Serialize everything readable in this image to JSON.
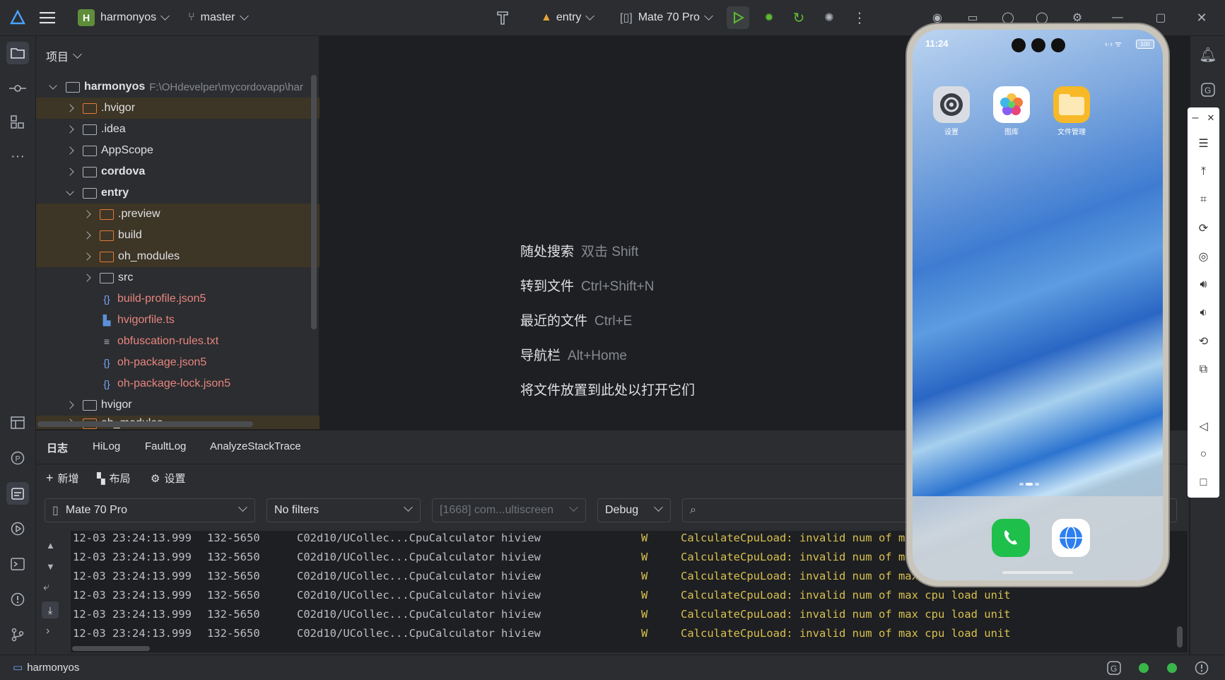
{
  "titlebar": {
    "project_badge": "H",
    "project_name": "harmonyos",
    "branch": "master",
    "run_config": "entry",
    "device": "Mate 70 Pro"
  },
  "project_panel": {
    "title": "项目",
    "root_name": "harmonyos",
    "root_path": "F:\\OHdevelper\\mycordovapp\\har",
    "items": [
      {
        "label": ".hvigor"
      },
      {
        "label": ".idea"
      },
      {
        "label": "AppScope"
      },
      {
        "label": "cordova"
      },
      {
        "label": "entry"
      },
      {
        "label": ".preview"
      },
      {
        "label": "build"
      },
      {
        "label": "oh_modules"
      },
      {
        "label": "src"
      },
      {
        "label": "build-profile.json5"
      },
      {
        "label": "hvigorfile.ts"
      },
      {
        "label": "obfuscation-rules.txt"
      },
      {
        "label": "oh-package.json5"
      },
      {
        "label": "oh-package-lock.json5"
      },
      {
        "label": "hvigor"
      },
      {
        "label": "oh_modules"
      }
    ]
  },
  "editor_hints": [
    {
      "label": "随处搜索",
      "key": "双击 Shift"
    },
    {
      "label": "转到文件",
      "key": "Ctrl+Shift+N"
    },
    {
      "label": "最近的文件",
      "key": "Ctrl+E"
    },
    {
      "label": "导航栏",
      "key": "Alt+Home"
    },
    {
      "label": "将文件放置到此处以打开它们",
      "key": ""
    }
  ],
  "log_panel": {
    "tabs": [
      "日志",
      "HiLog",
      "FaultLog",
      "AnalyzeStackTrace"
    ],
    "toolbar": {
      "new": "新增",
      "layout": "布局",
      "settings": "设置"
    },
    "device_select": "Mate 70 Pro",
    "filter_select": "No filters",
    "process_select": "[1668] com...ultiscreen",
    "level_select": "Debug",
    "rows": [
      {
        "time": "12-03 23:24:13.999",
        "pid": "132-5650",
        "tag": "C02d10/UCollec...CpuCalculator",
        "proc": "hiview",
        "level": "W",
        "msg": "CalculateCpuLoad: invalid num of max cpu load unit"
      },
      {
        "time": "12-03 23:24:13.999",
        "pid": "132-5650",
        "tag": "C02d10/UCollec...CpuCalculator",
        "proc": "hiview",
        "level": "W",
        "msg": "CalculateCpuLoad: invalid num of max cpu load unit"
      },
      {
        "time": "12-03 23:24:13.999",
        "pid": "132-5650",
        "tag": "C02d10/UCollec...CpuCalculator",
        "proc": "hiview",
        "level": "W",
        "msg": "CalculateCpuLoad: invalid num of max cpu load unit"
      },
      {
        "time": "12-03 23:24:13.999",
        "pid": "132-5650",
        "tag": "C02d10/UCollec...CpuCalculator",
        "proc": "hiview",
        "level": "W",
        "msg": "CalculateCpuLoad: invalid num of max cpu load unit"
      },
      {
        "time": "12-03 23:24:13.999",
        "pid": "132-5650",
        "tag": "C02d10/UCollec...CpuCalculator",
        "proc": "hiview",
        "level": "W",
        "msg": "CalculateCpuLoad: invalid num of max cpu load unit"
      },
      {
        "time": "12-03 23:24:13.999",
        "pid": "132-5650",
        "tag": "C02d10/UCollec...CpuCalculator",
        "proc": "hiview",
        "level": "W",
        "msg": "CalculateCpuLoad: invalid num of max cpu load unit"
      }
    ]
  },
  "phone": {
    "time": "11:24",
    "battery": "100",
    "apps": [
      {
        "label": "设置",
        "icon": "settings-app-icon",
        "color": "#d9dde3"
      },
      {
        "label": "图库",
        "icon": "gallery-app-icon",
        "color": "#ffffff"
      },
      {
        "label": "文件管理",
        "icon": "files-app-icon",
        "color": "#f7b928"
      }
    ],
    "dock": [
      {
        "icon": "phone-app-icon",
        "color": "#1fbf4c"
      },
      {
        "icon": "browser-app-icon",
        "color": "#ffffff"
      }
    ]
  },
  "statusbar": {
    "project": "harmonyos"
  },
  "colors": {
    "accent_green": "#5fb832",
    "warning_yellow": "#d8c04f",
    "highlight_row": "#3d3525"
  }
}
